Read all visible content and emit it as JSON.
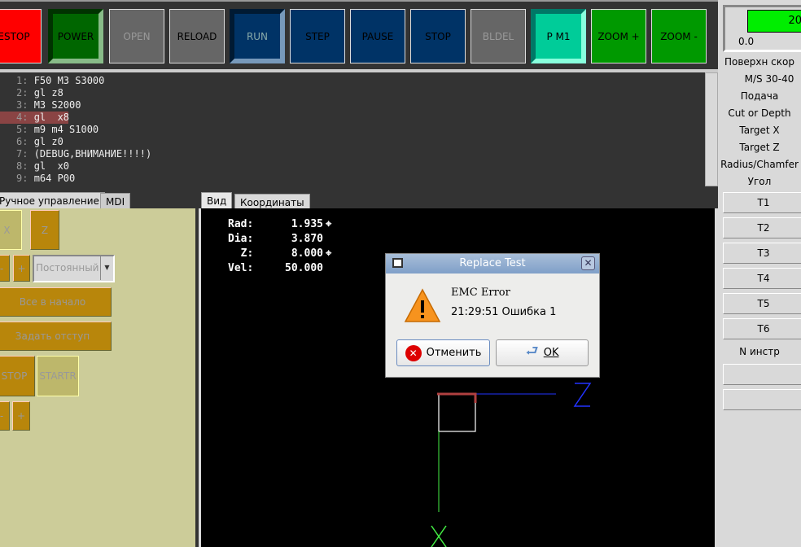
{
  "toolbar": {
    "buttons": [
      {
        "label": "ESTOP",
        "bg": "#ff0000",
        "fg": "#000"
      },
      {
        "label": "POWER",
        "bg": "#006600",
        "fg": "#000"
      },
      {
        "label": "OPEN",
        "bg": "#666666",
        "fg": "#999"
      },
      {
        "label": "RELOAD",
        "bg": "#666666",
        "fg": "#000"
      },
      {
        "label": "RUN",
        "bg": "#003366",
        "fg": "#8aa"
      },
      {
        "label": "STEP",
        "bg": "#003366",
        "fg": "#000"
      },
      {
        "label": "PAUSE",
        "bg": "#003366",
        "fg": "#000"
      },
      {
        "label": "STOP",
        "bg": "#003366",
        "fg": "#000"
      },
      {
        "label": "BLDEL",
        "bg": "#666666",
        "fg": "#999"
      },
      {
        "label": "P M1",
        "bg": "#00cc99",
        "fg": "#000"
      },
      {
        "label": "ZOOM +",
        "bg": "#009900",
        "fg": "#000"
      },
      {
        "label": "ZOOM -",
        "bg": "#009900",
        "fg": "#000"
      }
    ]
  },
  "code": {
    "lines": [
      {
        "n": "1:",
        "t": "F50 M3 S3000"
      },
      {
        "n": "2:",
        "t": "gl z8"
      },
      {
        "n": "3:",
        "t": "M3 S2000"
      },
      {
        "n": "4:",
        "t": "gl  x8"
      },
      {
        "n": "5:",
        "t": "m9 m4 S1000"
      },
      {
        "n": "6:",
        "t": "gl z0"
      },
      {
        "n": "7:",
        "t": "(DEBUG,ВНИМАНИЕ!!!!)"
      },
      {
        "n": "8:",
        "t": "gl  x0"
      },
      {
        "n": "9:",
        "t": "m64 P00"
      }
    ],
    "current_line": 4
  },
  "right": {
    "gauge_value": "20",
    "gauge_min": "0.0",
    "labels": [
      "Поверхн скор",
      "M/S 30-40",
      "Подача",
      "Cut or Depth",
      "Target X",
      "Target Z",
      "Radius/Chamfer",
      "Угол"
    ],
    "tools": [
      "T1",
      "T2",
      "T3",
      "T4",
      "T5",
      "T6"
    ],
    "tool_label": "N инстр"
  },
  "left": {
    "tabs": [
      "Ручное управление",
      "MDI"
    ],
    "x": "X",
    "z": "Z",
    "minus": "-",
    "plus": "+",
    "mode": "Постоянный",
    "home_all": "Все в начало",
    "set_offset": "Задать отступ",
    "stop": "STOP",
    "start": "STARTR"
  },
  "view": {
    "tabs": [
      "Вид",
      "Координаты"
    ],
    "dro": [
      {
        "k": "Rad:",
        "v": "1.935"
      },
      {
        "k": "Dia:",
        "v": "3.870"
      },
      {
        "k": "  Z:",
        "v": "8.000"
      },
      {
        "k": "Vel:",
        "v": "50.000"
      }
    ],
    "axis_z": "Z",
    "axis_x": "X"
  },
  "dialog": {
    "title": "Replace Test",
    "heading": "EMC Error",
    "message": "21:29:51 Ошибка 1",
    "cancel": "Отменить",
    "ok": "OK"
  }
}
